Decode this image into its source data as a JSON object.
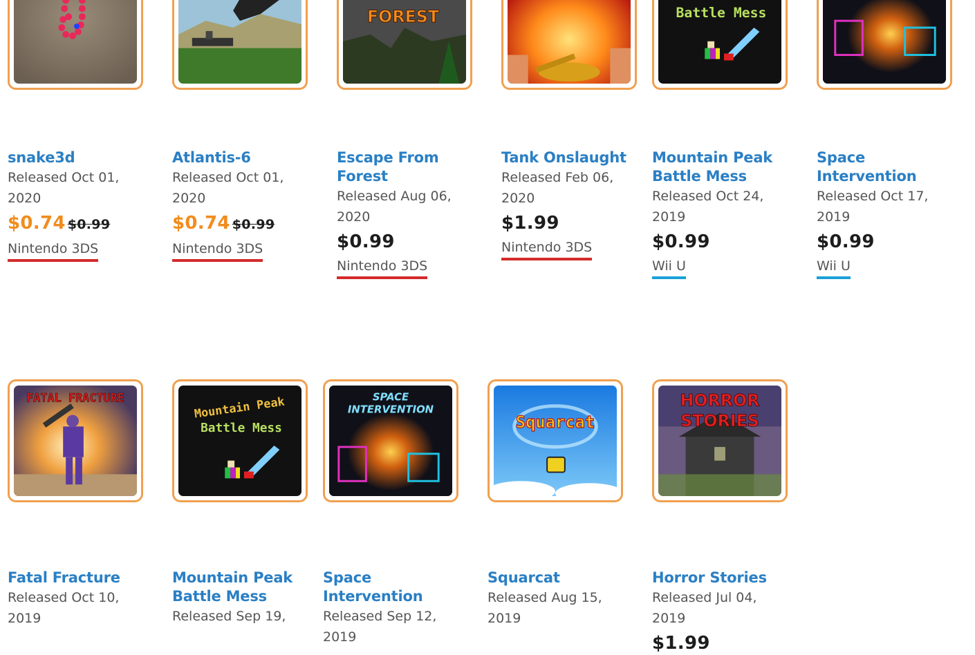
{
  "colors": {
    "accent_link": "#2a7fc4",
    "sale_price": "#f28c1e",
    "platform_3ds": "#d42b2b",
    "platform_wiiu": "#1aa0d9",
    "thumb_border": "#f0a050"
  },
  "games": [
    {
      "title": "snake3d",
      "released": "Released Oct 01, 2020",
      "price": "$0.74",
      "was": "$0.99",
      "platform": "Nintendo 3DS",
      "art": "snake"
    },
    {
      "title": "Atlantis-6",
      "released": "Released Oct 01, 2020",
      "price": "$0.74",
      "was": "$0.99",
      "platform": "Nintendo 3DS",
      "art": "atlantis"
    },
    {
      "title": "Escape From Forest",
      "released": "Released Aug 06, 2020",
      "price": "$0.99",
      "platform": "Nintendo 3DS",
      "art": "forest",
      "art_text": "FOREST"
    },
    {
      "title": "Tank Onslaught",
      "released": "Released Feb 06, 2020",
      "price": "$1.99",
      "platform": "Nintendo 3DS",
      "art": "tank"
    },
    {
      "title": "Mountain Peak Battle Mess",
      "released": "Released Oct 24, 2019",
      "price": "$0.99",
      "platform": "Wii U",
      "art": "mountain-top",
      "art_text": "Battle Mess"
    },
    {
      "title": "Space Intervention",
      "released": "Released Oct 17, 2019",
      "price": "$0.99",
      "platform": "Wii U",
      "art": "space-top"
    },
    {
      "title": "Fatal Fracture",
      "released": "Released Oct 10, 2019",
      "art": "fatal",
      "art_text": "FATAL FRACTURE"
    },
    {
      "title": "Mountain Peak Battle Mess",
      "released": "Released Sep 19,",
      "art": "mountain",
      "art_text_1": "Mountain Peak",
      "art_text_2": "Battle Mess"
    },
    {
      "title": "Space Intervention",
      "released": "Released Sep 12, 2019",
      "art": "space",
      "art_text_1": "SPACE",
      "art_text_2": "INTERVENTION"
    },
    {
      "title": "Squarcat",
      "released": "Released Aug 15, 2019",
      "art": "squarcat",
      "art_text": "Squarcat"
    },
    {
      "title": "Horror Stories",
      "released": "Released Jul 04, 2019",
      "price": "$1.99",
      "art": "horror",
      "art_text_1": "HORROR",
      "art_text_2": "STORIES"
    }
  ]
}
